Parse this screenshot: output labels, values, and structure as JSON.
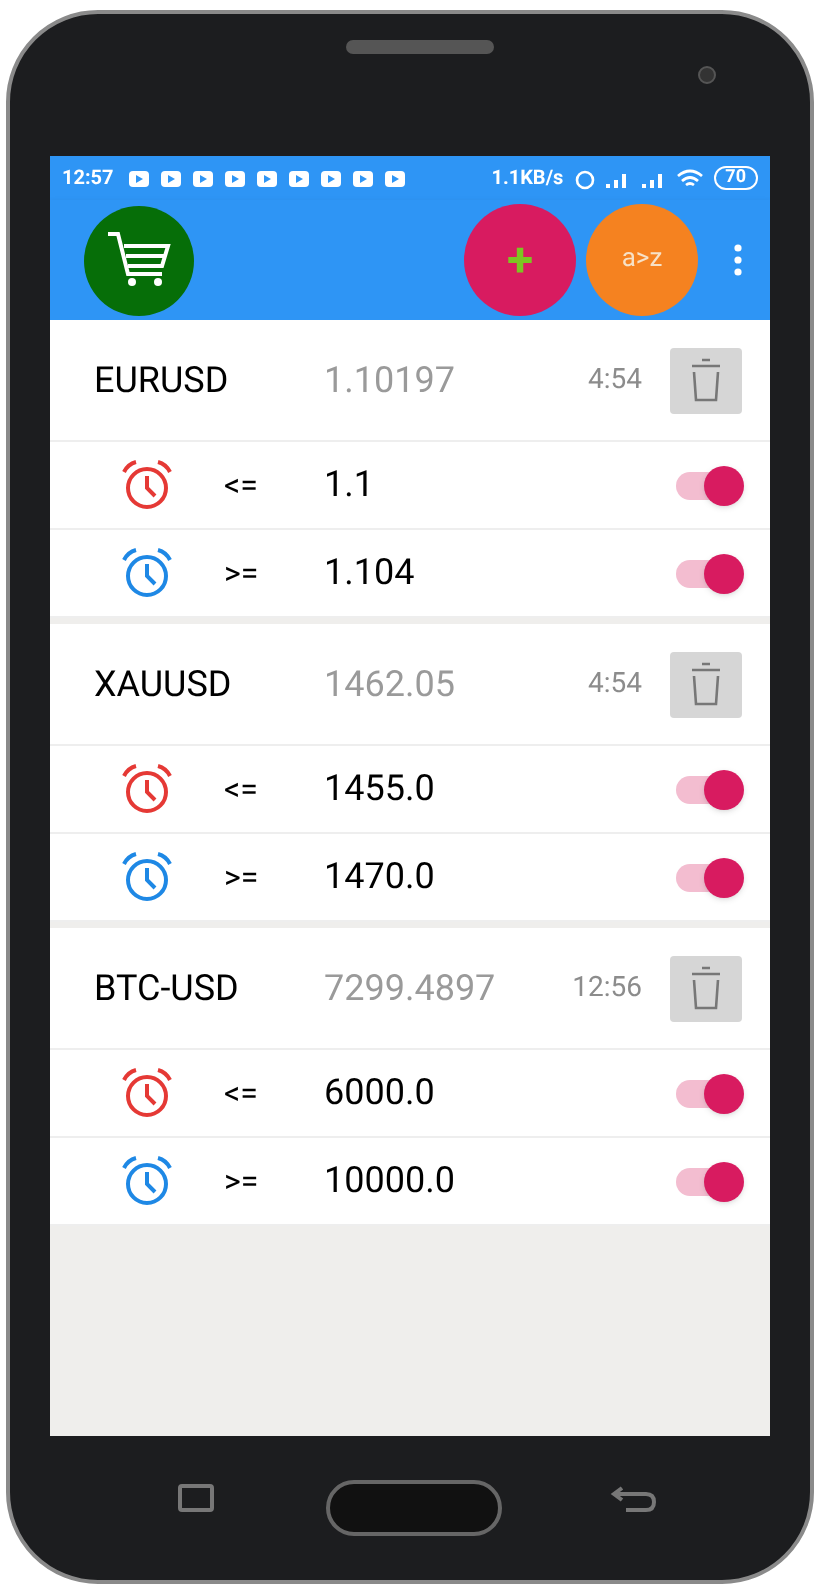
{
  "status_bar": {
    "time": "12:57",
    "speed": "1.1KB/s",
    "battery": "70"
  },
  "toolbar": {
    "add_label": "+",
    "sort_label": "a>z"
  },
  "symbols": [
    {
      "name": "EURUSD",
      "price": "1.10197",
      "time": "4:54",
      "alerts": [
        {
          "kind": "below",
          "operator": "<=",
          "value": "1.1",
          "on": true
        },
        {
          "kind": "above",
          "operator": ">=",
          "value": "1.104",
          "on": true
        }
      ]
    },
    {
      "name": "XAUUSD",
      "price": "1462.05",
      "time": "4:54",
      "alerts": [
        {
          "kind": "below",
          "operator": "<=",
          "value": "1455.0",
          "on": true
        },
        {
          "kind": "above",
          "operator": ">=",
          "value": "1470.0",
          "on": true
        }
      ]
    },
    {
      "name": "BTC-USD",
      "price": "7299.4897",
      "time": "12:56",
      "alerts": [
        {
          "kind": "below",
          "operator": "<=",
          "value": "6000.0",
          "on": true
        },
        {
          "kind": "above",
          "operator": ">=",
          "value": "10000.0",
          "on": true
        }
      ]
    }
  ]
}
